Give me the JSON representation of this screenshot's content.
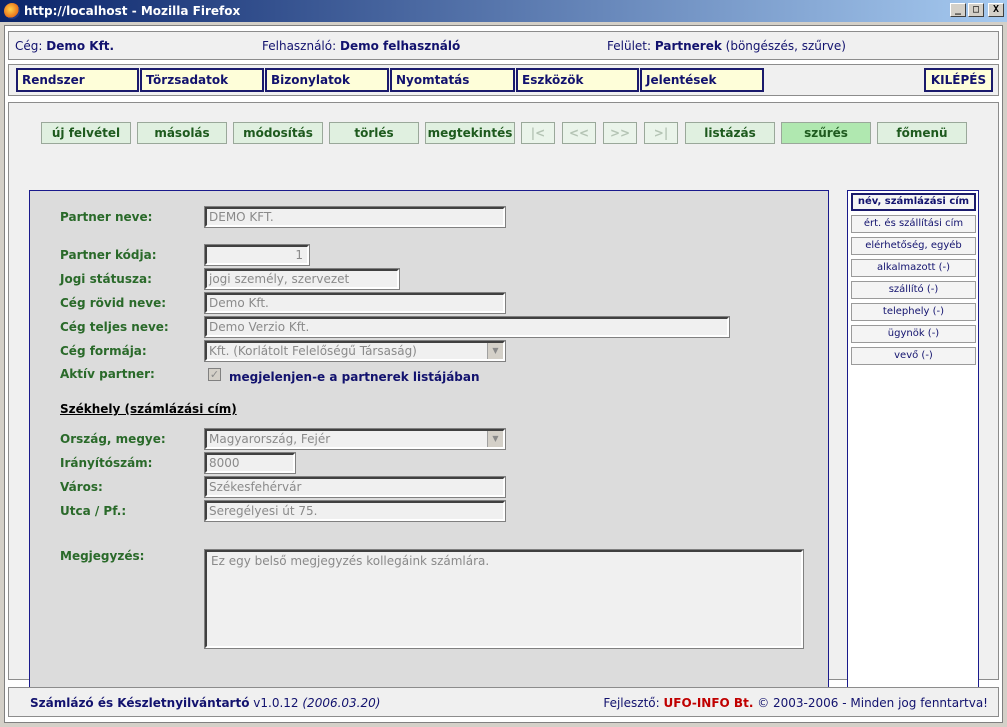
{
  "window": {
    "title": "http://localhost - Mozilla Firefox",
    "buttons": {
      "minimize": "_",
      "maximize": "□",
      "close": "X"
    }
  },
  "info": {
    "company_label": "Cég:",
    "company_value": "Demo Kft.",
    "user_label": "Felhasználó:",
    "user_value": "Demo felhasználó",
    "surface_label": "Felület:",
    "surface_value": "Partnerek",
    "surface_note": "(böngészés, szűrve)"
  },
  "menu": {
    "items": [
      "Rendszer",
      "Törzsadatok",
      "Bizonylatok",
      "Nyomtatás",
      "Eszközök",
      "Jelentések"
    ],
    "exit": "KILÉPÉS"
  },
  "toolbar": {
    "new": "új felvétel",
    "copy": "másolás",
    "edit": "módosítás",
    "delete": "törlés",
    "view": "megtekintés",
    "first": "|<",
    "prev": "<<",
    "next": ">>",
    "last": ">|",
    "list": "listázás",
    "filter": "szűrés",
    "main_menu": "főmenü"
  },
  "form": {
    "partner_name_label": "Partner neve:",
    "partner_name": "DEMO KFT.",
    "partner_code_label": "Partner kódja:",
    "partner_code": "1",
    "legal_status_label": "Jogi státusza:",
    "legal_status": "jogi személy, szervezet",
    "short_name_label": "Cég rövid neve:",
    "short_name": "Demo Kft.",
    "full_name_label": "Cég teljes neve:",
    "full_name": "Demo Verzio Kft.",
    "company_form_label": "Cég formája:",
    "company_form": "Kft. (Korlátolt Felelőségű Társaság)",
    "active_label": "Aktív partner:",
    "active_checked": "✓",
    "active_text": "megjelenjen-e a partnerek listájában",
    "hq_title": "Székhely (számlázási cím)",
    "country_label": "Ország, megye:",
    "country": "Magyarország, Fejér",
    "zip_label": "Irányítószám:",
    "zip": "8000",
    "city_label": "Város:",
    "city": "Székesfehérvár",
    "street_label": "Utca / Pf.:",
    "street": "Seregélyesi út 75.",
    "note_label": "Megjegyzés:",
    "note": "Ez egy belső megjegyzés kollegáink számlára."
  },
  "sidetabs": [
    "név, számlázási cím",
    "ért. és szállítási cím",
    "elérhetőség, egyéb",
    "alkalmazott (-)",
    "szállító (-)",
    "telephely (-)",
    "ügynök (-)",
    "vevő (-)"
  ],
  "footer": {
    "app_name": "Számlázó és Készletnyilvántartó",
    "version": "v1.0.12",
    "date": "(2006.03.20)",
    "dev_label": "Fejlesztő:",
    "dev_name": "UFO-INFO Bt.",
    "copyright": "© 2003-2006 - Minden jog fenntartva!"
  }
}
